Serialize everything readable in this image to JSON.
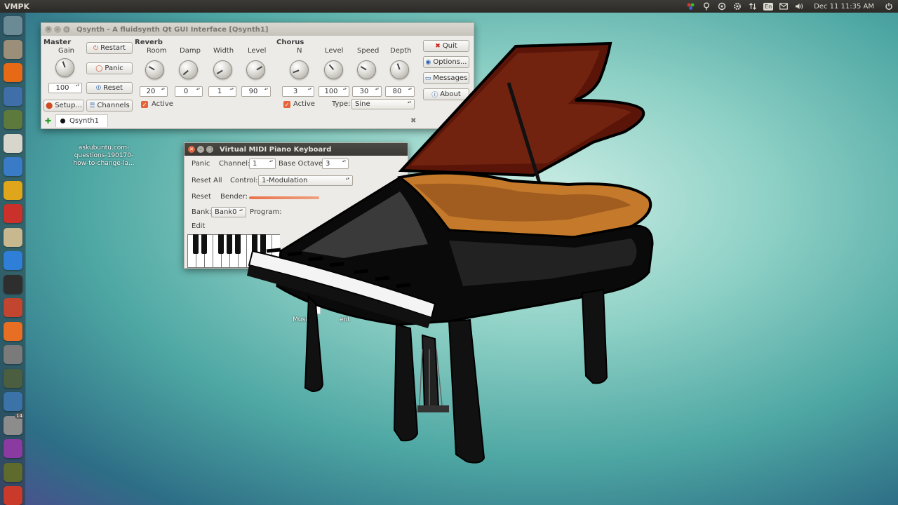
{
  "top_panel": {
    "app_name": "VMPK",
    "clock": "Dec 11 11:35 AM",
    "indicators": [
      "network-icon",
      "location-icon",
      "sync-icon",
      "settings-icon",
      "transfer-icon",
      "keyboard-layout",
      "mail-icon",
      "volume-icon",
      "power-icon"
    ],
    "keyboard_layout_label": "En"
  },
  "launcher": {
    "items": [
      {
        "icon": "dash-icon",
        "color": "#6a8a96"
      },
      {
        "icon": "files-icon",
        "color": "#9b8f7a"
      },
      {
        "icon": "firefox-icon",
        "color": "#e66a16"
      },
      {
        "icon": "thunderbird-icon",
        "color": "#3f6ea8"
      },
      {
        "icon": "chameleon-icon",
        "color": "#5d7a3c"
      },
      {
        "icon": "text-editor-icon",
        "color": "#d8d5cc"
      },
      {
        "icon": "writer-icon",
        "color": "#3a7bc8"
      },
      {
        "icon": "vlc-icon",
        "color": "#e0a61b"
      },
      {
        "icon": "acrobat-icon",
        "color": "#c9312a"
      },
      {
        "icon": "speaker-icon",
        "color": "#c7b890"
      },
      {
        "icon": "media-player-icon",
        "color": "#2f7ed8"
      },
      {
        "icon": "terminal-icon",
        "color": "#2e2e2e"
      },
      {
        "icon": "system-settings-icon",
        "color": "#c2462f"
      },
      {
        "icon": "software-center-icon",
        "color": "#e86e23"
      },
      {
        "icon": "calculator-icon",
        "color": "#7a7a7a"
      },
      {
        "icon": "mixer-icon",
        "color": "#4b5e3f"
      },
      {
        "icon": "python-icon",
        "color": "#3b73a8"
      },
      {
        "icon": "updates-icon",
        "color": "#8c8c8c",
        "badge": "14"
      },
      {
        "icon": "purple-app-icon",
        "color": "#8a3aa1"
      },
      {
        "icon": "pencil-icon",
        "color": "#5e6b2c"
      },
      {
        "icon": "synth-icon",
        "color": "#c93a2a"
      }
    ]
  },
  "desktop": {
    "file1": [
      "askubuntu.com-",
      "questions-190170-",
      "how-to-change-la..."
    ],
    "file2": "Music A",
    "file2_rest": "ent"
  },
  "qsynth": {
    "title": "Qsynth - A fluidsynth Qt GUI Interface [Qsynth1]",
    "master_label": "Master",
    "gain_label": "Gain",
    "gain_value": "100",
    "restart_label": "Restart",
    "panic_label": "Panic",
    "reset_label": "Reset",
    "setup_label": "Setup...",
    "channels_label": "Channels",
    "reverb": {
      "label": "Reverb",
      "room_label": "Room",
      "room_value": "20",
      "damp_label": "Damp",
      "damp_value": "0",
      "width_label": "Width",
      "width_value": "1",
      "level_label": "Level",
      "level_value": "90",
      "active_label": "Active"
    },
    "chorus": {
      "label": "Chorus",
      "n_label": "N",
      "n_value": "3",
      "level_label": "Level",
      "level_value": "100",
      "speed_label": "Speed",
      "speed_value": "30",
      "depth_label": "Depth",
      "depth_value": "80",
      "active_label": "Active",
      "type_label": "Type:",
      "type_value": "Sine"
    },
    "quit_label": "Quit",
    "options_label": "Options...",
    "messages_label": "Messages",
    "about_label": "About",
    "tab_label": "Qsynth1",
    "add_tab_glyph": "✚",
    "close_tab_glyph": "✖"
  },
  "vmpk": {
    "title": "Virtual MIDI Piano Keyboard",
    "panic_label": "Panic",
    "channel_label": "Channel:",
    "channel_value": "1",
    "base_octave_label": "Base Octave:",
    "base_octave_value": "3",
    "reset_all_label": "Reset All",
    "control_label": "Control:",
    "control_value": "1-Modulation",
    "reset_label": "Reset",
    "bender_label": "Bender:",
    "bank_label": "Bank:",
    "bank_value": "Bank0",
    "program_label": "Program:",
    "edit_label": "Edit"
  },
  "colors": {
    "accent": "#e4633a",
    "titlebar_active": "#3a3935",
    "panel": "#2b2a27"
  }
}
